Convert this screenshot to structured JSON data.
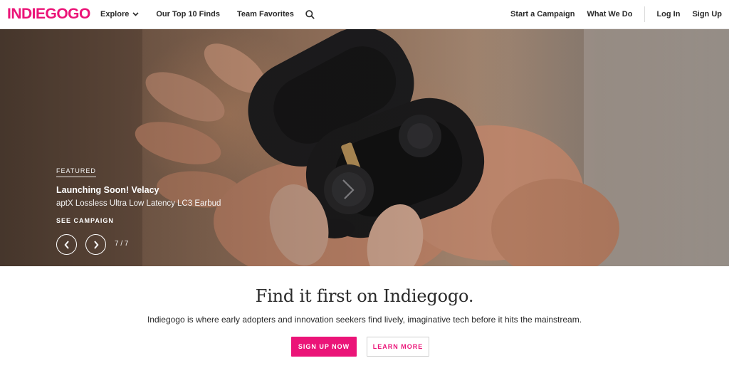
{
  "header": {
    "logo": "INDIEGOGO",
    "nav_left": [
      {
        "label": "Explore",
        "icon": "chevron-down-icon"
      },
      {
        "label": "Our Top 10 Finds"
      },
      {
        "label": "Team Favorites"
      }
    ],
    "search_icon": "search-icon",
    "nav_right": [
      {
        "label": "Start a Campaign"
      },
      {
        "label": "What We Do"
      },
      {
        "label": "Log In"
      },
      {
        "label": "Sign Up"
      }
    ]
  },
  "hero": {
    "tag": "FEATURED",
    "title": "Launching Soon! Velacy",
    "subtitle": "aptX Lossless Ultra Low Latency LC3 Earbud",
    "cta": "SEE CAMPAIGN",
    "prev_icon": "chevron-left-icon",
    "next_icon": "chevron-right-icon",
    "slide_counter": "7 / 7"
  },
  "promo": {
    "title": "Find it first on Indiegogo.",
    "description": "Indiegogo is where early adopters and innovation seekers find lively, imaginative tech before it hits the mainstream.",
    "primary_button": "SIGN UP NOW",
    "secondary_button": "LEARN MORE"
  },
  "colors": {
    "brand": "#eb1478",
    "text": "#2a2a2a",
    "border": "#e6e6e6"
  }
}
